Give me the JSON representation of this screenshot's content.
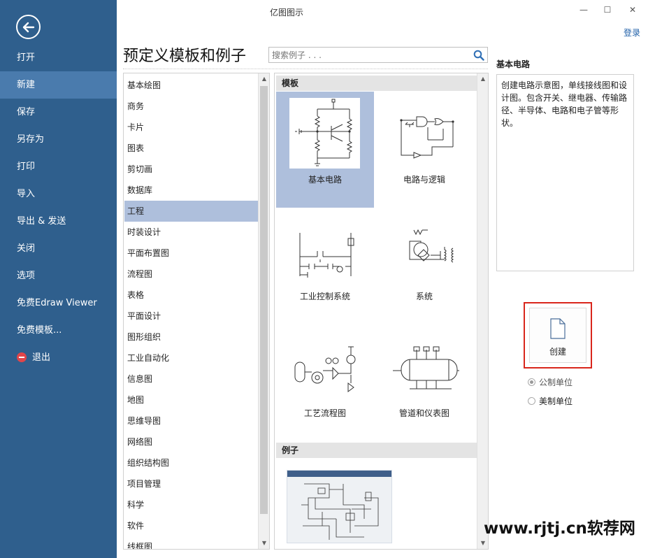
{
  "window": {
    "title": "亿图图示",
    "minimize": "—",
    "maximize": "☐",
    "close": "✕",
    "login": "登录"
  },
  "sidebar": {
    "items": [
      {
        "label": "打开"
      },
      {
        "label": "新建"
      },
      {
        "label": "保存"
      },
      {
        "label": "另存为"
      },
      {
        "label": "打印"
      },
      {
        "label": "导入"
      },
      {
        "label": "导出 & 发送"
      },
      {
        "label": "关闭"
      },
      {
        "label": "选项"
      },
      {
        "label": "免费Edraw Viewer"
      },
      {
        "label": "免费模板..."
      },
      {
        "label": "退出"
      }
    ],
    "active_index": 1,
    "accent_color": "#2f5f8d"
  },
  "main": {
    "title": "预定义模板和例子",
    "search": {
      "placeholder": "搜索例子 . . ."
    }
  },
  "categories": {
    "items": [
      "基本绘图",
      "商务",
      "卡片",
      "图表",
      "剪切画",
      "数据库",
      "工程",
      "时装设计",
      "平面布置图",
      "流程图",
      "表格",
      "平面设计",
      "图形组织",
      "工业自动化",
      "信息图",
      "地图",
      "思维导图",
      "网络图",
      "组织结构图",
      "项目管理",
      "科学",
      "软件",
      "线框图"
    ],
    "selected": "工程"
  },
  "templates": {
    "section_label": "模板",
    "tiles": [
      {
        "label": "基本电路",
        "icon": "basic-circuit-icon"
      },
      {
        "label": "电路与逻辑",
        "icon": "logic-circuit-icon"
      },
      {
        "label": "工业控制系统",
        "icon": "industrial-control-icon"
      },
      {
        "label": "系统",
        "icon": "system-icon"
      },
      {
        "label": "工艺流程图",
        "icon": "process-flow-icon"
      },
      {
        "label": "管道和仪表图",
        "icon": "piping-instrument-icon"
      }
    ],
    "selected": "基本电路"
  },
  "examples": {
    "section_label": "例子"
  },
  "detail": {
    "title": "基本电路",
    "description": "创建电路示意图，单线接线图和设计图。包含开关、继电器、传输路径、半导体、电路和电子管等形状。"
  },
  "create": {
    "label": "创建",
    "icon": "new-document-icon"
  },
  "units": {
    "metric": "公制单位",
    "us": "美制单位",
    "selected": "metric"
  },
  "watermark": "www.rjtj.cn软荐网"
}
